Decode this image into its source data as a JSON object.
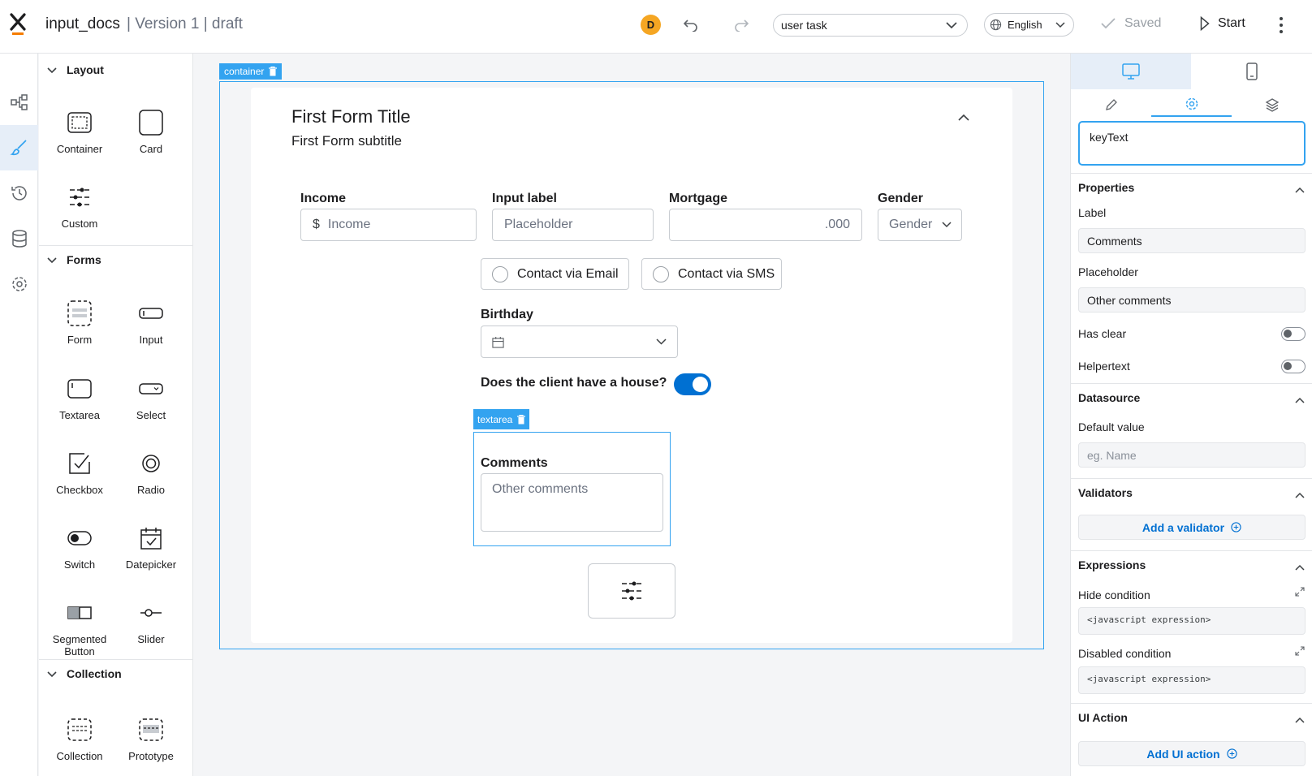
{
  "header": {
    "title": "input_docs",
    "version_text": "| Version 1 | draft",
    "avatar_initial": "D",
    "task_select": "user task",
    "language_select": "English",
    "saved_label": "Saved",
    "start_label": "Start"
  },
  "components": {
    "layout": {
      "title": "Layout",
      "items": [
        "Container",
        "Card",
        "Custom"
      ]
    },
    "forms": {
      "title": "Forms",
      "items": [
        "Form",
        "Input",
        "Textarea",
        "Select",
        "Checkbox",
        "Radio",
        "Switch",
        "Datepicker",
        "Segmented Button",
        "Slider"
      ]
    },
    "collection": {
      "title": "Collection",
      "items": [
        "Collection",
        "Prototype"
      ]
    }
  },
  "canvas": {
    "container_tag": "container",
    "form_title": "First Form Title",
    "form_subtitle": "First Form subtitle",
    "income": {
      "label": "Income",
      "prefix": "$",
      "placeholder": "Income"
    },
    "input": {
      "label": "Input label",
      "placeholder": "Placeholder"
    },
    "mortgage": {
      "label": "Mortgage",
      "suffix": ".000"
    },
    "gender": {
      "label": "Gender",
      "placeholder": "Gender"
    },
    "radio_options": [
      "Contact via Email",
      "Contact via SMS"
    ],
    "birthday": {
      "label": "Birthday"
    },
    "house_switch": {
      "label": "Does the client have a house?",
      "on": true
    },
    "textarea_tag": "textarea",
    "comments": {
      "label": "Comments",
      "placeholder": "Other comments"
    }
  },
  "properties_panel": {
    "key": "keyText",
    "properties": {
      "title": "Properties",
      "label_label": "Label",
      "label_value": "Comments",
      "placeholder_label": "Placeholder",
      "placeholder_value": "Other comments",
      "has_clear_label": "Has clear",
      "has_clear": false,
      "helpertext_label": "Helpertext",
      "helpertext": false
    },
    "datasource": {
      "title": "Datasource",
      "default_value_label": "Default value",
      "default_value_placeholder": "eg. Name"
    },
    "validators": {
      "title": "Validators",
      "add_label": "Add a validator"
    },
    "expressions": {
      "title": "Expressions",
      "hide_label": "Hide condition",
      "hide_placeholder": "<javascript expression>",
      "disabled_label": "Disabled condition",
      "disabled_placeholder": "<javascript expression>"
    },
    "ui_action": {
      "title": "UI Action",
      "add_label": "Add UI action"
    }
  },
  "colors": {
    "accent": "#33a3f0",
    "primary": "#0070d2",
    "logo_orange": "#f57c00",
    "avatar": "#f5a623"
  }
}
